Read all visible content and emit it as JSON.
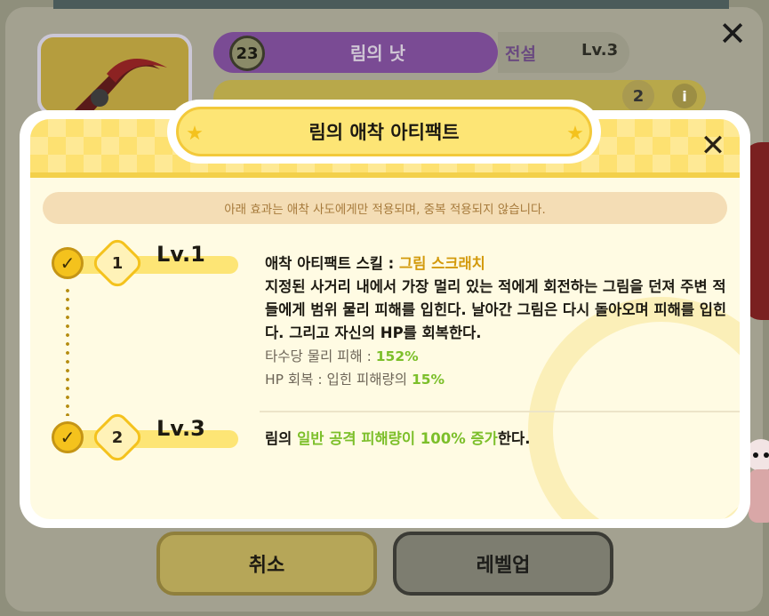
{
  "background": {
    "level_number": "23",
    "character_name": "림의 낫",
    "rank": "전설",
    "level": "Lv.3",
    "sub_badge": "2",
    "info_icon": "i"
  },
  "modal": {
    "title": "림의 애착 아티팩트",
    "notice": "아래 효과는 애착 사도에게만 적용되며, 중복 적용되지 않습니다.",
    "levels": [
      {
        "badge": "1",
        "label": "Lv.1",
        "skill_prefix": "애착 아티팩트 스킬 : ",
        "skill_name": "그림 스크래치",
        "description": "지정된 사거리 내에서 가장 멀리 있는 적에게 회전하는 그림을 던져 주변 적들에게 범위 물리 피해를 입힌다. 날아간 그림은 다시 돌아오며 피해를 입힌다. 그리고 자신의 HP를 회복한다.",
        "stat1_label": "타수당 물리 피해 : ",
        "stat1_value": "152%",
        "stat2_label": "HP 회복 : 입힌 피해량의 ",
        "stat2_value": "15%"
      },
      {
        "badge": "2",
        "label": "Lv.3",
        "text_prefix": "림의 ",
        "text_highlight": "일반 공격 피해량이 100% 증가",
        "text_suffix": "한다."
      }
    ]
  },
  "buttons": {
    "cancel": "취소",
    "level_up": "레벨업"
  },
  "colors": {
    "header_yellow": "#fde171",
    "accent_gold": "#d39a0c",
    "value_green": "#7cbf2a",
    "purple": "#7a4b94"
  }
}
